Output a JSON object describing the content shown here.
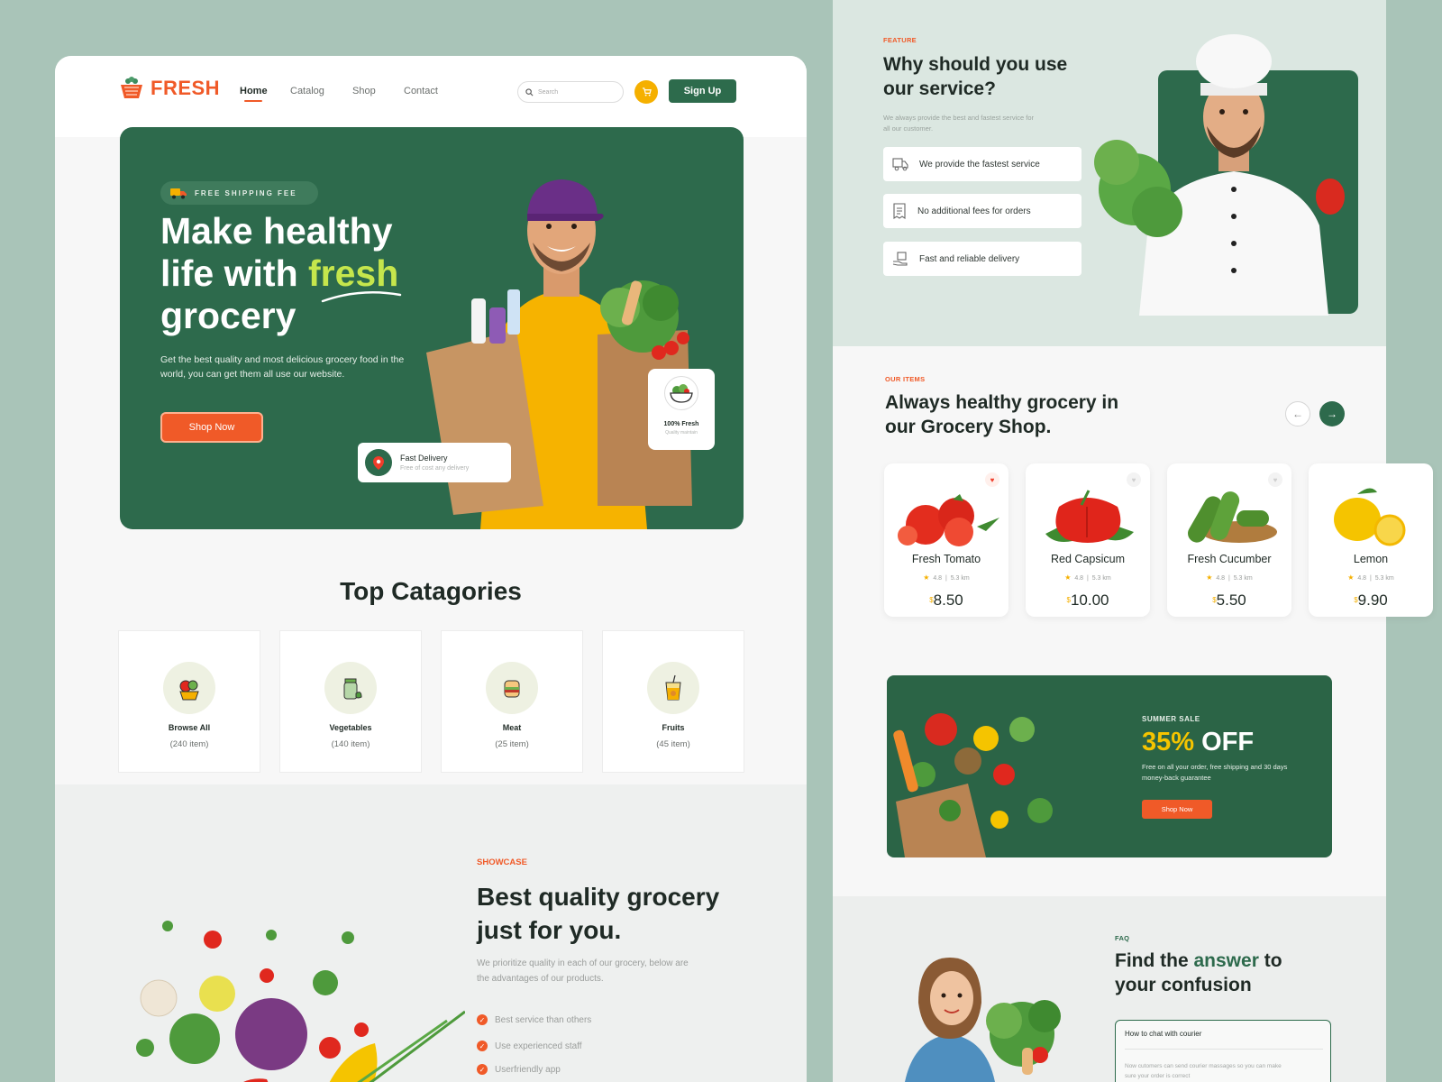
{
  "brand": {
    "name": "FRESH"
  },
  "nav": {
    "links": [
      "Home",
      "Catalog",
      "Shop",
      "Contact"
    ],
    "search_placeholder": "Search",
    "signup_label": "Sign Up"
  },
  "hero": {
    "badge": "FREE SHIPPING FEE",
    "title_line1": "Make healthy",
    "title_line2_pre": "life with ",
    "title_line2_hl": "fresh",
    "title_line3": "grocery",
    "subtitle": "Get the best quality and most delicious grocery food in the world, you can get them all use our website.",
    "cta": "Shop Now",
    "fast_delivery_title": "Fast Delivery",
    "fast_delivery_sub": "Free of cost any delivery",
    "fresh_title": "100% Fresh",
    "fresh_sub": "Quality maintain"
  },
  "categories": {
    "title": "Top Catagories",
    "items": [
      {
        "name": "Browse All",
        "count": "(240 item)",
        "icon": "fruit-basket-icon"
      },
      {
        "name": "Vegetables",
        "count": "(140 item)",
        "icon": "jar-icon"
      },
      {
        "name": "Meat",
        "count": "(25 item)",
        "icon": "sandwich-icon"
      },
      {
        "name": "Fruits",
        "count": "(45 item)",
        "icon": "juice-icon"
      }
    ]
  },
  "showcase": {
    "label": "SHOWCASE",
    "title": "Best quality grocery just for you.",
    "text": "We prioritize quality in each of our grocery, below are the advantages of our products.",
    "points": [
      "Best service than others",
      "Use experienced staff",
      "Userfriendly app"
    ]
  },
  "feature": {
    "label": "FEATURE",
    "title": "Why should you use our service?",
    "text": "We always provide the best and fastest service for all our customer.",
    "items": [
      {
        "label": "We provide the fastest service",
        "icon": "delivery-truck-icon"
      },
      {
        "label": "No additional fees for orders",
        "icon": "receipt-icon"
      },
      {
        "label": "Fast and reliable delivery",
        "icon": "hand-box-icon"
      }
    ]
  },
  "items_section": {
    "label": "OUR ITEMS",
    "title": "Always healthy grocery in our Grocery Shop.",
    "products": [
      {
        "name": "Fresh Tomato",
        "rating": "4.8",
        "distance": "5.3 km",
        "currency": "$",
        "price": "8.50",
        "favorite": true
      },
      {
        "name": "Red Capsicum",
        "rating": "4.8",
        "distance": "5.3 km",
        "currency": "$",
        "price": "10.00",
        "favorite": false
      },
      {
        "name": "Fresh Cucumber",
        "rating": "4.8",
        "distance": "5.3 km",
        "currency": "$",
        "price": "5.50",
        "favorite": false
      },
      {
        "name": "Lemon",
        "rating": "4.8",
        "distance": "5.3 km",
        "currency": "$",
        "price": "9.90",
        "favorite": false
      }
    ]
  },
  "sale": {
    "label": "SUMMER SALE",
    "percent": "35%",
    "off": "OFF",
    "text": "Free on all your order, free shipping and 30 days money-back guarantee",
    "cta": "Shop Now"
  },
  "faq": {
    "label": "FAQ",
    "title_pre": "Find the ",
    "title_hl": "answer",
    "title_post": " to your confusion",
    "question": "How to chat with courier",
    "answer": "Now cutomers can send courier massages so you can make sure your order is correct"
  },
  "colors": {
    "primary_green": "#2d6a4c",
    "accent_orange": "#f05a28",
    "accent_yellow": "#f5b000",
    "lime": "#c6e64c"
  }
}
